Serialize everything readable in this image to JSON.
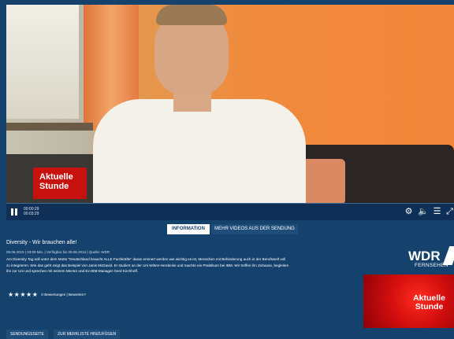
{
  "video": {
    "overlay_logo_text": "Aktuelle\nStunde"
  },
  "controls": {
    "current_time": "00:00:29",
    "duration": "00:03:29",
    "icons": [
      "pause-icon",
      "gear-icon",
      "volume-icon",
      "settings-sliders-icon",
      "fullscreen-icon"
    ]
  },
  "tabs": [
    {
      "label": "INFORMATION",
      "active": true
    },
    {
      "label": "MEHR VIDEOS AUS DER SENDUNG",
      "active": false
    }
  ],
  "info": {
    "title": "Diversity - Wir brauchen alle!",
    "meta": "09.06.2015 | 03:09 Min. | Verfügbar bis 09.06.2016 | Quelle: WDR",
    "description": "Am Diversity Tag soll unter dem Motto \"Deutschland braucht ALLE Fachkräfte\" daran erinnert werden wie wichtig es ist, Menschen mit Behinderung auch in der Berufswelt voll zu integrieren. Wie das geht zeigt das Beispiel von Janis McDavid. Er studiert an der Uni Witten-Herdecke und machte ein Praktikum bei IBM. Wir treffen ihn Zuhause, begleiten ihn zur Uni und sprechen mit seinem Mentor und Ex-IBM-Manager Gerd Kirchhoff.",
    "stars": "★★★★★",
    "rating_text": "0 Bewertungen | Bewerten?"
  },
  "branding": {
    "wdr": "WDR",
    "wdr_sub": "FERNSEHEN",
    "show_logo_text": "Aktuelle\nStunde"
  },
  "buttons": {
    "show_page": "SENDUNGSSEITE",
    "watchlist": "ZUR MERKLISTE HINZUFÜGEN"
  },
  "colors": {
    "background": "#15426c",
    "control_bar": "#0f2f57",
    "brand_red": "#c6110f"
  }
}
